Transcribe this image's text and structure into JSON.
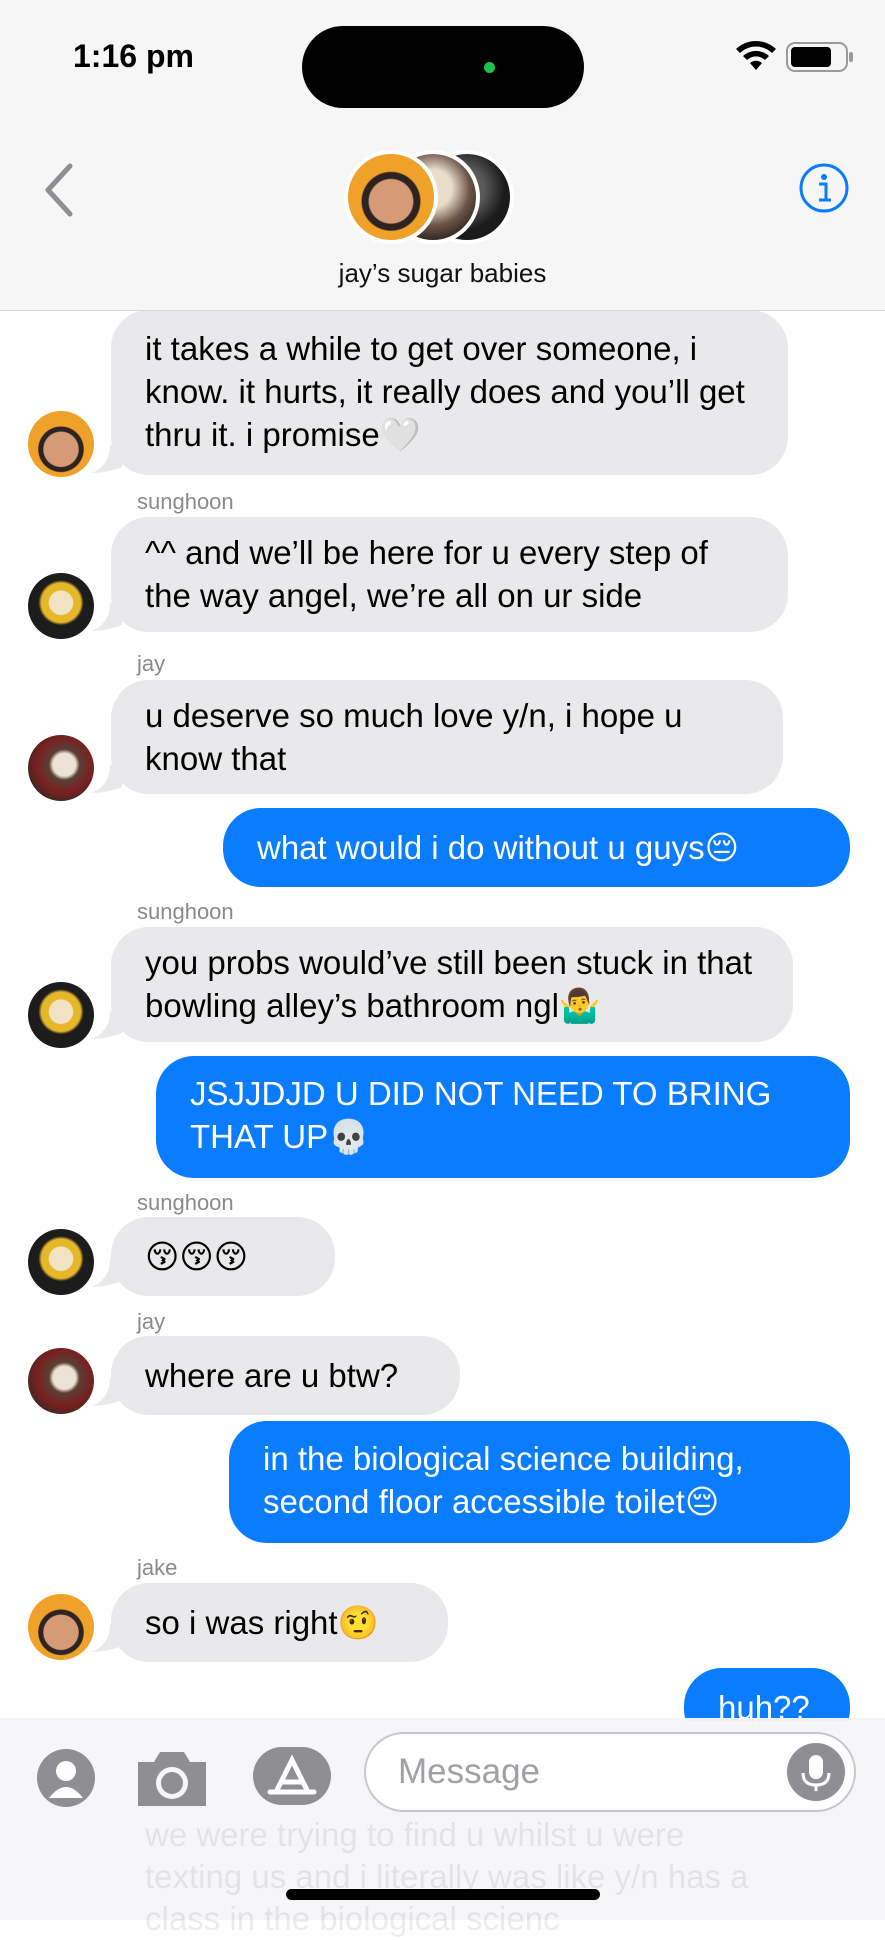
{
  "status_bar": {
    "time": "1:16 pm"
  },
  "header": {
    "group_name": "jay’s sugar babies"
  },
  "messages": [
    {
      "sender": "",
      "text": "it takes a while to get over someone, i know. it hurts, it really does and you’ll get thru it. i promise🤍"
    },
    {
      "sender": "sunghoon",
      "text": "^^ and we’ll be here for u every step of the way angel, we’re all on ur side"
    },
    {
      "sender": "jay",
      "text": "u deserve so much love y/n, i hope u know that"
    },
    {
      "sender": "me",
      "text": "what would i do without u guys😔"
    },
    {
      "sender": "sunghoon",
      "text": "you probs would’ve still been stuck in that bowling alley’s bathroom ngl🤷‍♂️"
    },
    {
      "sender": "me",
      "text": "JSJJDJD U DID NOT NEED TO BRING THAT UP💀"
    },
    {
      "sender": "sunghoon",
      "text": "😚😚😚"
    },
    {
      "sender": "jay",
      "text": "where are u btw?"
    },
    {
      "sender": "me",
      "text": "in the biological science building, second floor accessible toilet😔"
    },
    {
      "sender": "jake",
      "text": "so i was right🤨"
    },
    {
      "sender": "me",
      "text": "huh??"
    }
  ],
  "input": {
    "placeholder": "Message",
    "ghost_text": "we were trying to find u whilst u were texting us and i literally was like y/n has a class in the biological scienc"
  },
  "icons": [
    "wifi-icon",
    "battery-icon",
    "back-chevron-icon",
    "info-icon",
    "contact-icon",
    "camera-icon",
    "app-store-icon",
    "mic-icon"
  ],
  "colors": {
    "outgoing_bubble": "#0a7cff",
    "incoming_bubble": "#e9e9eb",
    "accent": "#0a7cff"
  }
}
